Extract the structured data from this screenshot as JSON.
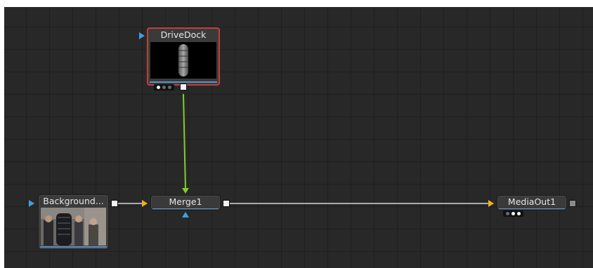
{
  "nodes": {
    "drivedock": {
      "title": "DriveDock",
      "selected": true
    },
    "background": {
      "title": "Background..."
    },
    "merge": {
      "title": "Merge1"
    },
    "mediaout": {
      "title": "MediaOut1"
    }
  },
  "colors": {
    "canvas_bg": "#282828",
    "grid_line": "#1f1f1f",
    "node_bg": "#3a3a3a",
    "selected_outline": "#c0403a",
    "main_wire": "#d8d8d8",
    "mask_wire": "#7bd02a",
    "input_blue": "#3f9fe0",
    "input_yellow": "#f0b020",
    "active_line_blue": "#5b93c9"
  },
  "icons": {
    "output_port": "white-square",
    "background_input": "blue-triangle",
    "foreground_input": "yellow-triangle",
    "mask_input": "blue-up-triangle",
    "view_dots": "three-dots"
  }
}
